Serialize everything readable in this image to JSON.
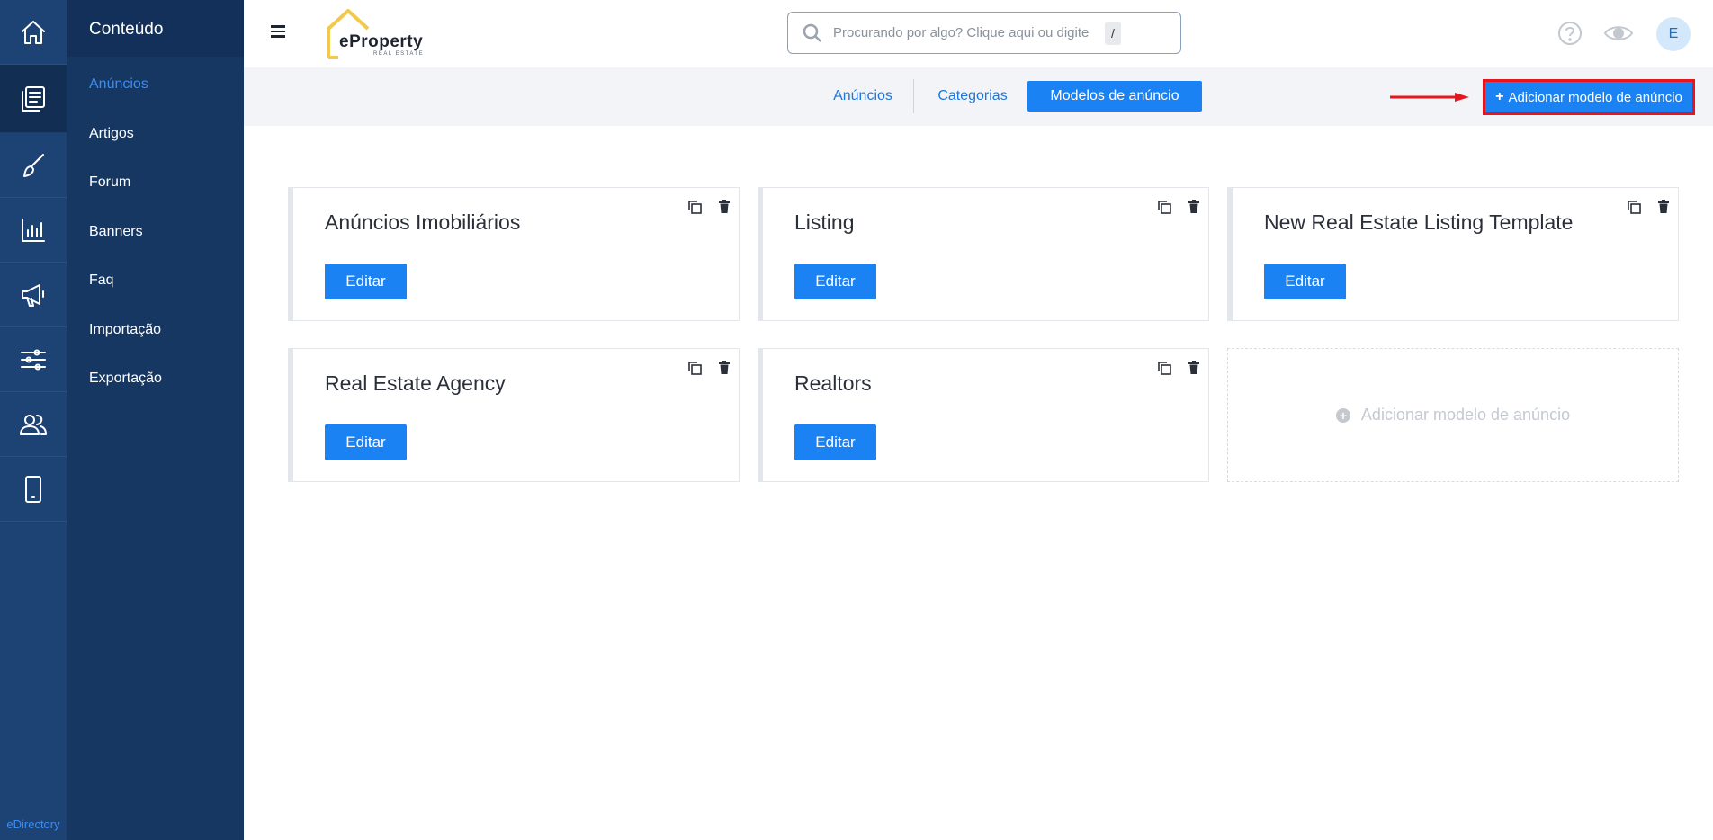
{
  "rail": {
    "items": [
      {
        "icon": "home-icon"
      },
      {
        "icon": "content-icon",
        "active": true
      },
      {
        "icon": "brush-icon"
      },
      {
        "icon": "chart-icon"
      },
      {
        "icon": "megaphone-icon"
      },
      {
        "icon": "sliders-icon"
      },
      {
        "icon": "users-icon"
      },
      {
        "icon": "mobile-icon"
      }
    ],
    "footer": "eDirectory"
  },
  "subnav": {
    "title": "Conteúdo",
    "items": [
      {
        "label": "Anúncios",
        "active": true
      },
      {
        "label": "Artigos"
      },
      {
        "label": "Forum"
      },
      {
        "label": "Banners"
      },
      {
        "label": "Faq"
      },
      {
        "label": "Importação"
      },
      {
        "label": "Exportação"
      }
    ]
  },
  "header": {
    "logo_text": "eProperty",
    "logo_sub": "REAL ESTATE",
    "search_placeholder": "Procurando por algo? Clique aqui ou digite",
    "search_shortcut": "/",
    "avatar_initial": "E"
  },
  "tabs": {
    "items": [
      "Anúncios",
      "Categorias",
      "Modelos de anúncio"
    ],
    "active_index": 2,
    "add_button": "Adicionar modelo de anúncio"
  },
  "templates": {
    "edit_label": "Editar",
    "cards": [
      {
        "title": "Anúncios Imobiliários"
      },
      {
        "title": "Listing"
      },
      {
        "title": "New Real Estate Listing Template"
      },
      {
        "title": "Real Estate Agency"
      },
      {
        "title": "Realtors"
      }
    ],
    "add_card_label": "Adicionar modelo de anúncio"
  },
  "colors": {
    "primary": "#1a82f3",
    "sidebar": "#1d4274",
    "highlight": "#e8141e"
  }
}
